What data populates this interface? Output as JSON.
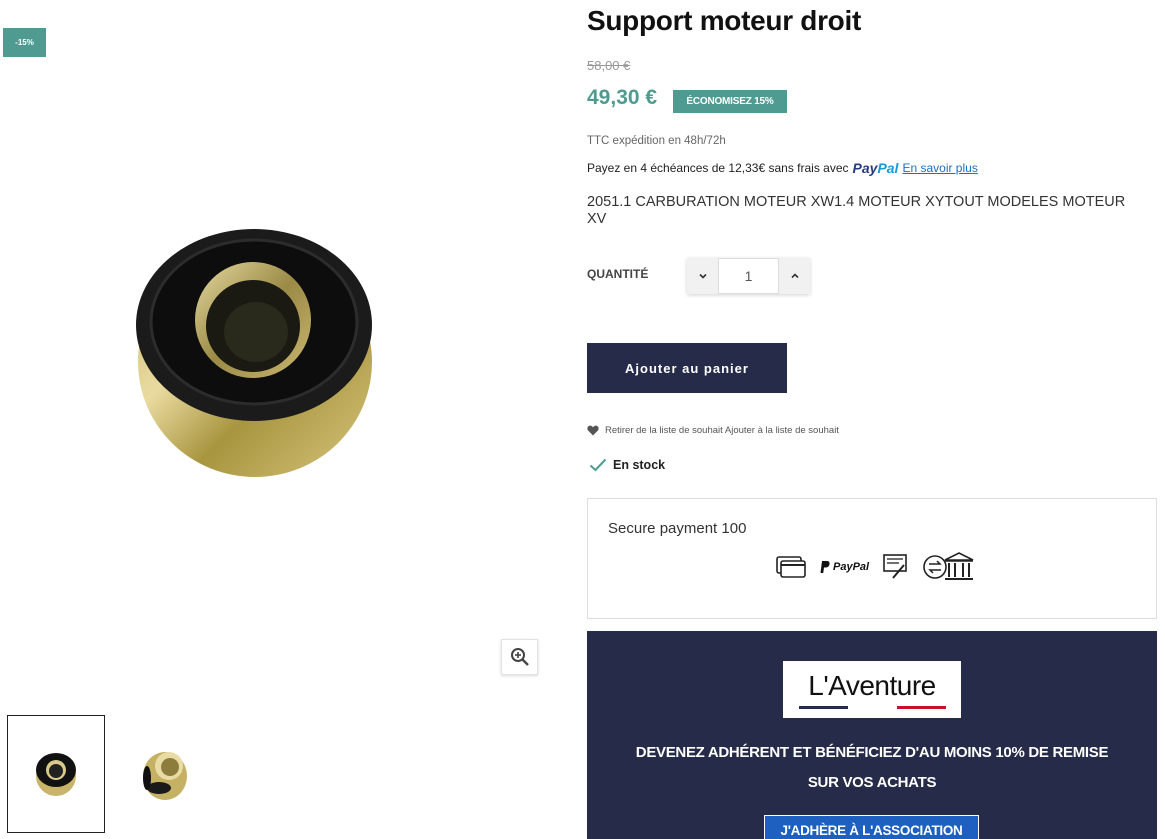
{
  "gallery": {
    "discount_flag": "-15%",
    "thumbnails": [
      {
        "name": "thumbnail-front"
      },
      {
        "name": "thumbnail-side"
      }
    ]
  },
  "product": {
    "title": "Support moteur droit",
    "old_price": "58,00 €",
    "price": "49,30 €",
    "save_badge": "ÉCONOMISEZ 15%",
    "shipping": "TTC expédition en 48h/72h",
    "paypal_text": "Payez en 4 échéances de 12,33€ sans frais avec",
    "paypal_brand_1": "Pay",
    "paypal_brand_2": "Pal",
    "paypal_link": "En savoir plus",
    "description": "2051.1 CARBURATION MOTEUR XW1.4 MOTEUR XYTOUT MODELES MOTEUR XV",
    "quantity_label": "QUANTITÉ",
    "quantity_value": "1",
    "add_to_cart": "Ajouter au panier",
    "wishlist_text": "Retirer de la liste de souhait Ajouter à la liste de souhait",
    "stock": "En stock"
  },
  "secure": {
    "title": "Secure payment 100",
    "icons": [
      "card-icon",
      "paypal-icon",
      "check-payment-icon",
      "bank-transfer-icon"
    ],
    "paypal_small": "PayPal"
  },
  "promo": {
    "logo": "L'Aventure",
    "text_line_1": "DEVENEZ ADHÉRENT ET BÉNÉFICIEZ D'AU MOINS 10% DE REMISE",
    "text_line_2": "SUR VOS ACHATS",
    "button": "J'ADHÈRE À L'ASSOCIATION"
  },
  "colors": {
    "accent": "#4f9b91",
    "dark": "#262b4a",
    "link": "#1a6fc6",
    "promo_button": "#1e60c0"
  }
}
